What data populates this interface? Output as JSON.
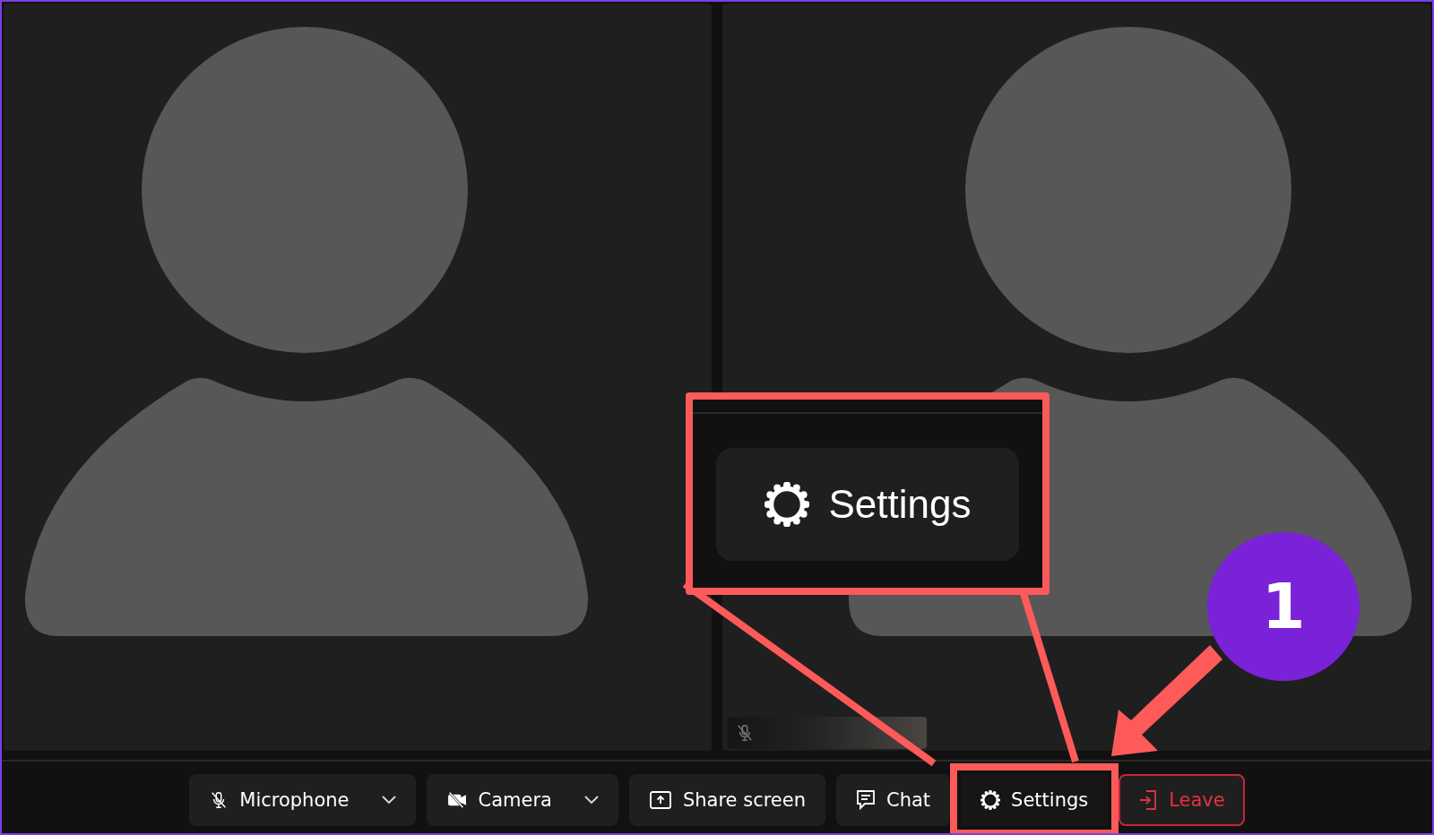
{
  "tiles": [
    {
      "kind": "avatar",
      "muted": false
    },
    {
      "kind": "avatar",
      "muted": true
    }
  ],
  "toolbar": [
    {
      "label": "Microphone",
      "kind": "microphone",
      "dropdown": true,
      "highlighted": false
    },
    {
      "label": "Camera",
      "kind": "camera",
      "dropdown": true,
      "highlighted": false
    },
    {
      "label": "Share screen",
      "kind": "share",
      "dropdown": false,
      "highlighted": false
    },
    {
      "label": "Chat",
      "kind": "chat",
      "dropdown": false,
      "highlighted": false
    },
    {
      "label": "Settings",
      "kind": "settings",
      "dropdown": false,
      "highlighted": true
    },
    {
      "label": "Leave",
      "kind": "leave",
      "dropdown": false,
      "highlighted": false
    }
  ],
  "callout": {
    "label": "Settings"
  },
  "step_badge": "1"
}
